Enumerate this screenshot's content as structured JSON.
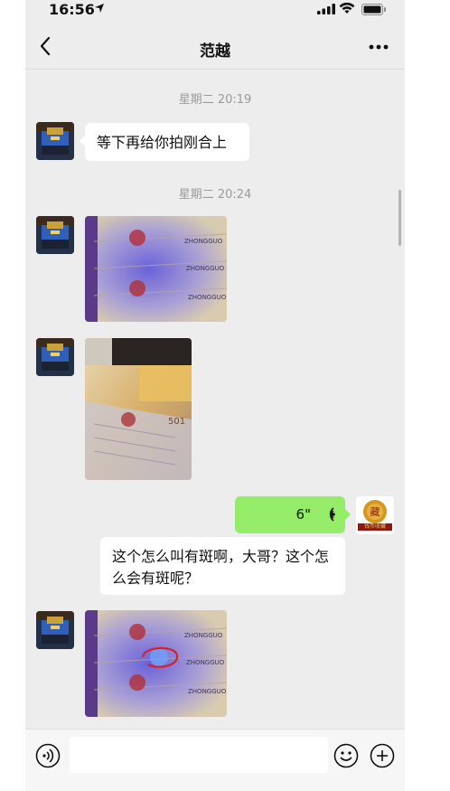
{
  "status_bar": {
    "time": "16:56"
  },
  "nav": {
    "title": "范越"
  },
  "messages": [
    {
      "type": "timestamp",
      "text": "星期二 20:19"
    },
    {
      "type": "text",
      "side": "left",
      "text": "等下再给你拍刚合上"
    },
    {
      "type": "timestamp",
      "text": "星期二 20:24"
    },
    {
      "type": "image",
      "side": "left",
      "subject": "banknotes under UV light"
    },
    {
      "type": "image",
      "side": "left",
      "subject": "stack of banknotes"
    },
    {
      "type": "voice",
      "side": "right",
      "duration": "6\""
    },
    {
      "type": "text",
      "side": "left",
      "text": "这个怎么叫有斑啊，大哥？这个怎么会有斑呢？"
    },
    {
      "type": "image",
      "side": "left",
      "subject": "banknotes with circled spot"
    }
  ],
  "my_avatar_text": "钱币收藏",
  "input": {
    "placeholder": ""
  },
  "colors": {
    "background": "#ededed",
    "sent_bubble": "#95ec69",
    "received_bubble": "#ffffff"
  },
  "icons": [
    "location-arrow-icon",
    "signal-icon",
    "wifi-icon",
    "battery-icon",
    "back-chevron-icon",
    "more-dots-icon",
    "voice-wave-icon",
    "voice-mode-icon",
    "emoji-icon",
    "plus-icon"
  ]
}
